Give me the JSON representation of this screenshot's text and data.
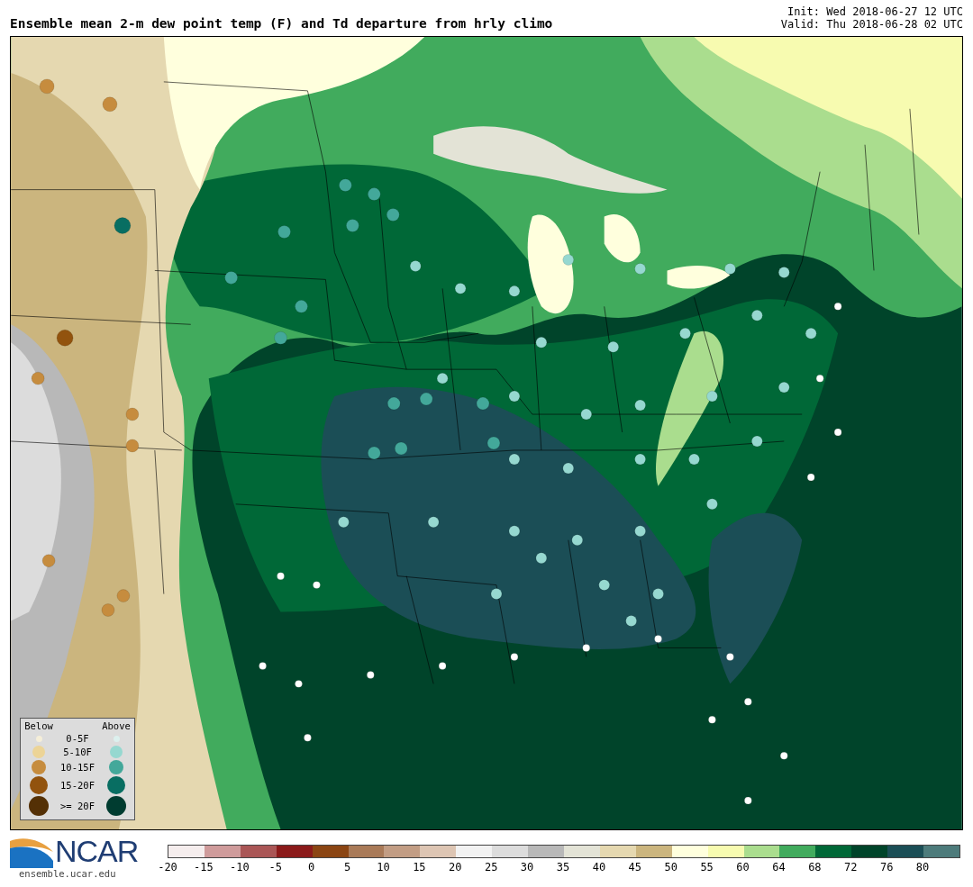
{
  "title": "Ensemble mean 2-m dew point temp (F) and Td departure from hrly climo",
  "init": "Init: Wed 2018-06-27 12 UTC",
  "valid": "Valid: Thu 2018-06-28 02 UTC",
  "legend": {
    "below_header": "Below",
    "above_header": "Above",
    "rows": [
      {
        "label": "0-5F",
        "below": {
          "color": "#f5eed8"
        },
        "above": {
          "color": "#dcf0ee"
        }
      },
      {
        "label": "5-10F",
        "below": {
          "color": "#ecd497"
        },
        "above": {
          "color": "#96d8d0"
        }
      },
      {
        "label": "10-15F",
        "below": {
          "color": "#c68c3e"
        },
        "above": {
          "color": "#43a89a"
        }
      },
      {
        "label": "15-20F",
        "below": {
          "color": "#92530e"
        },
        "above": {
          "color": "#086e62"
        }
      },
      {
        "label": ">= 20F",
        "below": {
          "color": "#543005"
        },
        "above": {
          "color": "#003c30"
        }
      }
    ]
  },
  "logo": {
    "wordmark": "NCAR",
    "url": "ensemble.ucar.edu"
  },
  "colorbar": {
    "swatches": [
      {
        "color": "#f5eded"
      },
      {
        "color": "#cf9b9b"
      },
      {
        "color": "#aa5656"
      },
      {
        "color": "#8b1a1a"
      },
      {
        "color": "#8b4513"
      },
      {
        "color": "#a97a58"
      },
      {
        "color": "#c29d84"
      },
      {
        "color": "#ddc5b3"
      },
      {
        "color": "#f2f2f2"
      },
      {
        "color": "#dcdcdc"
      },
      {
        "color": "#b8b8b8"
      },
      {
        "color": "#e3e3d6"
      },
      {
        "color": "#e5d8b0"
      },
      {
        "color": "#cbb57e"
      },
      {
        "color": "#ffffdd"
      },
      {
        "color": "#f7fbb0"
      },
      {
        "color": "#aadd8e"
      },
      {
        "color": "#41ab5d"
      },
      {
        "color": "#006837"
      },
      {
        "color": "#00442a"
      },
      {
        "color": "#1b4e56"
      },
      {
        "color": "#4d7b7b"
      }
    ],
    "ticks": [
      "-20",
      "-15",
      "-10",
      "-5",
      "0",
      "5",
      "10",
      "15",
      "20",
      "25",
      "30",
      "35",
      "40",
      "45",
      "50",
      "55",
      "60",
      "64",
      "68",
      "72",
      "76",
      "80"
    ]
  }
}
